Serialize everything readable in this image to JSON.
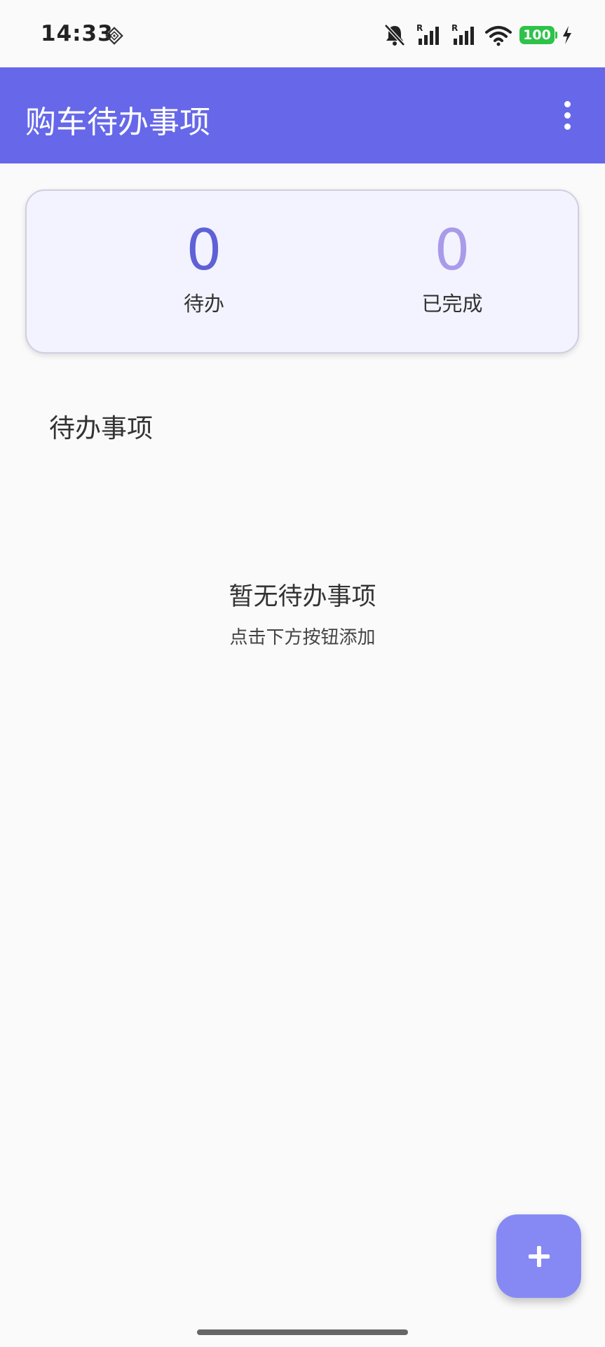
{
  "status_bar": {
    "time": "14:33",
    "battery": "100",
    "signal_1_label": "R",
    "signal_2_label": "R",
    "icons": [
      "diamond-icon",
      "bell-off-icon",
      "signal-icon",
      "signal-icon",
      "wifi-icon",
      "battery-icon",
      "charging-bolt-icon"
    ]
  },
  "app_bar": {
    "title": "购车待办事项",
    "menu_icon": "more-vert-icon",
    "background_color": "#6668e9"
  },
  "stats": {
    "pending": {
      "value": "0",
      "label": "待办",
      "color": "#5f61d6"
    },
    "completed": {
      "value": "0",
      "label": "已完成",
      "color": "#a99be9"
    }
  },
  "section": {
    "title": "待办事项"
  },
  "empty_state": {
    "title": "暂无待办事项",
    "subtitle": "点击下方按钮添加"
  },
  "fab": {
    "icon": "plus-icon",
    "color": "#8689f4"
  },
  "colors": {
    "battery": "#2ec24a",
    "background": "#fafafa",
    "card_background": "#f3f3ff"
  }
}
